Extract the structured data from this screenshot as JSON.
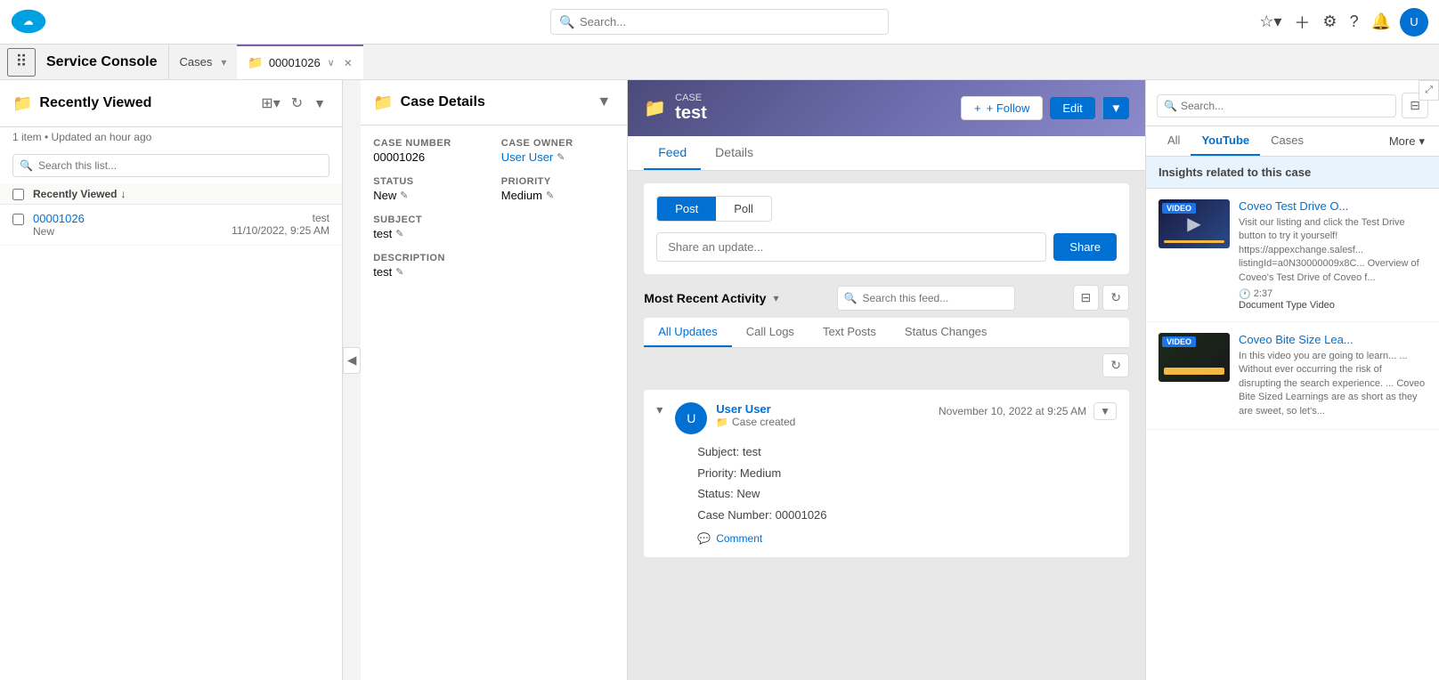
{
  "app": {
    "name": "Service Console",
    "logo_alt": "Salesforce"
  },
  "topnav": {
    "search_placeholder": "Search...",
    "icons": [
      "star",
      "plus",
      "cloud",
      "question",
      "gear",
      "bell"
    ]
  },
  "tabs": {
    "static_tab": "Cases",
    "active_tab": "00001026",
    "active_tab_icon": "📁"
  },
  "left_panel": {
    "title": "Recently Viewed",
    "icon": "📁",
    "meta": "1 item • Updated an hour ago",
    "search_placeholder": "Search this list...",
    "list_header": "Recently Viewed",
    "items": [
      {
        "id": "00001026",
        "status": "New",
        "label": "test",
        "date": "11/10/2022, 9:25 AM"
      }
    ]
  },
  "case_details": {
    "title": "Case Details",
    "icon": "📁",
    "case_number_label": "Case Number",
    "case_number": "00001026",
    "case_owner_label": "Case Owner",
    "case_owner": "User User",
    "status_label": "Status",
    "status": "New",
    "priority_label": "Priority",
    "priority": "Medium",
    "subject_label": "Subject",
    "subject": "test",
    "description_label": "Description",
    "description": "test"
  },
  "feed": {
    "case_label": "Case",
    "case_title": "test",
    "icon": "📁",
    "follow_label": "+ Follow",
    "edit_label": "Edit",
    "tabs": [
      "Feed",
      "Details"
    ],
    "active_tab": "Feed",
    "post_tabs": [
      "Post",
      "Poll"
    ],
    "active_post_tab": "Post",
    "post_placeholder": "Share an update...",
    "share_label": "Share",
    "activity_title": "Most Recent Activity",
    "activity_search_placeholder": "Search this feed...",
    "update_tabs": [
      "All Updates",
      "Call Logs",
      "Text Posts",
      "Status Changes"
    ],
    "active_update_tab": "All Updates",
    "feed_entry": {
      "user": "User User",
      "action": "Case created",
      "timestamp": "November 10, 2022 at 9:25 AM",
      "subject_line": "Subject: test",
      "priority_line": "Priority: Medium",
      "status_line": "Status: New",
      "case_number_line": "Case Number: 00001026",
      "comment_label": "Comment"
    }
  },
  "right_panel": {
    "search_placeholder": "Search...",
    "tabs": [
      "All",
      "YouTube",
      "Cases"
    ],
    "active_tab": "YouTube",
    "more_label": "More",
    "insights_label": "Insights related to this case",
    "videos": [
      {
        "badge": "VIDEO",
        "title": "Coveo Test Drive O...",
        "description": "Visit our listing and click the Test Drive button to try it yourself! https://appexchange.salesf... listingId=a0N30000009x8C... Overview of Coveo's Test Drive of Coveo f...",
        "duration": "2:37",
        "doc_type_label": "Document",
        "doc_type_value": "Type Video"
      },
      {
        "badge": "VIDEO",
        "title": "Coveo Bite Size Lea...",
        "description": "In this video you are going to learn... ... Without ever occurring the risk of disrupting the search experience. ... Coveo Bite Sized Learnings are as short as they are sweet, so let's..."
      }
    ]
  },
  "icons": {
    "search": "🔍",
    "chevron_down": "▼",
    "chevron_right": "▶",
    "refresh": "↻",
    "filter": "⊟",
    "grid": "⊞",
    "close": "✕",
    "plus": "＋",
    "edit": "✎",
    "comment": "💬",
    "clock": "🕐",
    "video_play": "▶"
  }
}
